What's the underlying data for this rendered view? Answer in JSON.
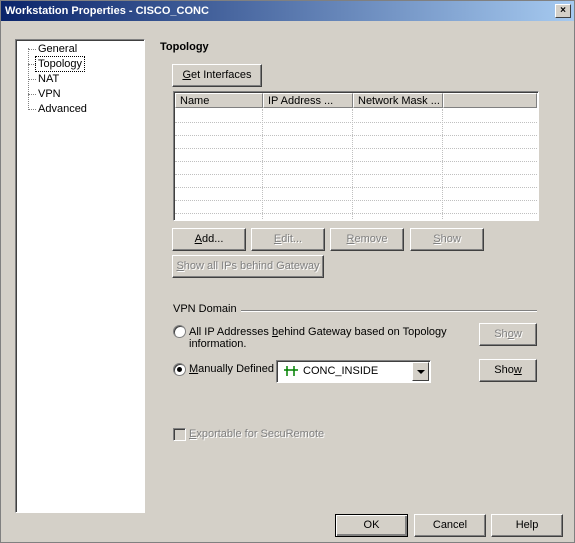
{
  "window": {
    "title": "Workstation Properties - CISCO_CONC",
    "close_glyph": "×"
  },
  "tree": {
    "items": [
      {
        "label": "General"
      },
      {
        "label": "Topology"
      },
      {
        "label": "NAT"
      },
      {
        "label": "VPN"
      },
      {
        "label": "Advanced"
      }
    ]
  },
  "topology": {
    "title": "Topology",
    "get_interfaces": {
      "u": "G",
      "rest": "et Interfaces"
    },
    "columns": [
      "Name",
      "IP Address    ...",
      "Network Mask ...",
      ""
    ],
    "rows": [],
    "add": {
      "u": "A",
      "rest": "dd..."
    },
    "edit": {
      "u": "E",
      "rest": "dit..."
    },
    "remove": {
      "u": "R",
      "rest": "emove"
    },
    "show": {
      "u": "S",
      "rest": "how"
    },
    "show_all": {
      "u": "S",
      "rest": "how all IPs behind Gateway"
    }
  },
  "vpn_domain": {
    "label": "VPN Domain",
    "option_all": {
      "pre": "All IP Addresses ",
      "u": "b",
      "rest": "ehind Gateway based on Topology",
      "line2": "information."
    },
    "option_manual": {
      "u": "M",
      "rest": "anually Defined"
    },
    "selected": "manual",
    "show1": {
      "pre": "Sh",
      "u": "o",
      "rest": "w"
    },
    "manual_value": "CONC_INSIDE",
    "show2": {
      "pre": "Sho",
      "u": "w",
      "rest": ""
    }
  },
  "exportable": {
    "u": "E",
    "rest": "xportable for SecuRemote",
    "checked": false
  },
  "footer": {
    "ok": "OK",
    "cancel": "Cancel",
    "help": "Help"
  },
  "colors": {
    "title_start": "#0a246a",
    "title_end": "#a6caf0",
    "icon_green": "#008000"
  }
}
